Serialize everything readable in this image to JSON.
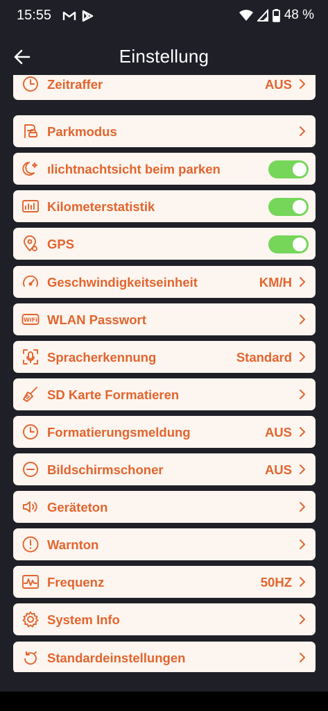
{
  "status_bar": {
    "time": "15:55",
    "battery": "48 %",
    "notification_icons": [
      "gmail-icon",
      "play-store-icon"
    ],
    "system_icons": [
      "wifi-icon",
      "signal-icon",
      "battery-icon"
    ]
  },
  "header": {
    "title": "Einstellung",
    "back_icon": "back-arrow-icon"
  },
  "accent_color": "#e2652f",
  "toggle_color": "#76d65a",
  "settings": [
    {
      "icon": "clock-icon",
      "label": "Zeitraffer",
      "value": "AUS",
      "control": "chevron"
    },
    {
      "icon": "parking-car-icon",
      "label": "Parkmodus",
      "value": "",
      "control": "chevron"
    },
    {
      "icon": "moon-icon",
      "label": "ılichtnachtsicht beim parken",
      "value": "",
      "control": "toggle",
      "toggle_on": true
    },
    {
      "icon": "chart-icon",
      "label": "Kilometerstatistik",
      "value": "",
      "control": "toggle",
      "toggle_on": true
    },
    {
      "icon": "gps-pin-icon",
      "label": "GPS",
      "value": "",
      "control": "toggle",
      "toggle_on": true
    },
    {
      "icon": "speedometer-icon",
      "label": "Geschwindigkeitseinheit",
      "value": "KM/H",
      "control": "chevron"
    },
    {
      "icon": "wifi-box-icon",
      "label": "WLAN Passwort",
      "value": "",
      "control": "chevron"
    },
    {
      "icon": "microphone-icon",
      "label": "Spracherkennung",
      "value": "Standard",
      "control": "chevron"
    },
    {
      "icon": "broom-icon",
      "label": "SD Karte Formatieren",
      "value": "",
      "control": "chevron"
    },
    {
      "icon": "clock-icon",
      "label": "Formatierungsmeldung",
      "value": "AUS",
      "control": "chevron"
    },
    {
      "icon": "minus-circle-icon",
      "label": "Bildschirmschoner",
      "value": "AUS",
      "control": "chevron"
    },
    {
      "icon": "speaker-icon",
      "label": "Geräteton",
      "value": "",
      "control": "chevron"
    },
    {
      "icon": "warning-circle-icon",
      "label": "Warnton",
      "value": "",
      "control": "chevron"
    },
    {
      "icon": "waveform-icon",
      "label": "Frequenz",
      "value": "50HZ",
      "control": "chevron"
    },
    {
      "icon": "gear-icon",
      "label": "System Info",
      "value": "",
      "control": "chevron"
    },
    {
      "icon": "reset-icon",
      "label": "Standardeinstellungen",
      "value": "",
      "control": "chevron"
    }
  ]
}
